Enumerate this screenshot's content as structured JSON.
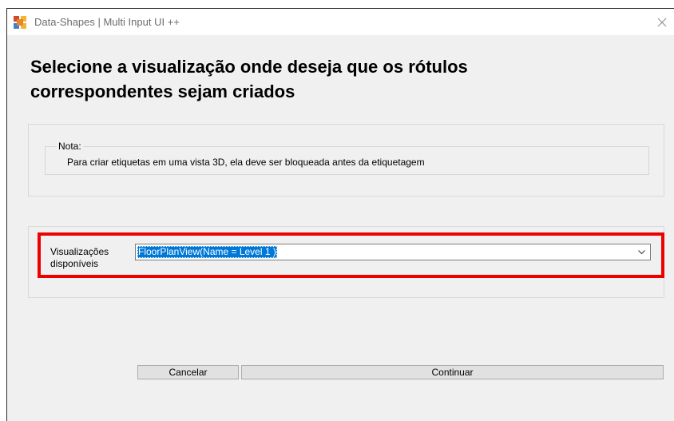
{
  "window": {
    "title": "Data-Shapes | Multi Input UI ++"
  },
  "heading": {
    "line1": "Selecione a visualização onde deseja que os rótulos",
    "line2": "correspondentes sejam criados"
  },
  "note": {
    "legend": "Nota:",
    "text": "Para criar etiquetas em uma vista 3D, ela deve ser bloqueada antes da etiquetagem"
  },
  "views_field": {
    "label_line1": "Visualizações",
    "label_line2": "disponíveis",
    "selected_value": "FloorPlanView(Name = Level 1 )",
    "highlight_color": "#ee0000",
    "selection_color": "#0078d7"
  },
  "buttons": {
    "cancel": "Cancelar",
    "continue": "Continuar"
  },
  "icons": {
    "app": "app-icon",
    "close": "close-icon",
    "dropdown": "chevron-down-icon"
  }
}
